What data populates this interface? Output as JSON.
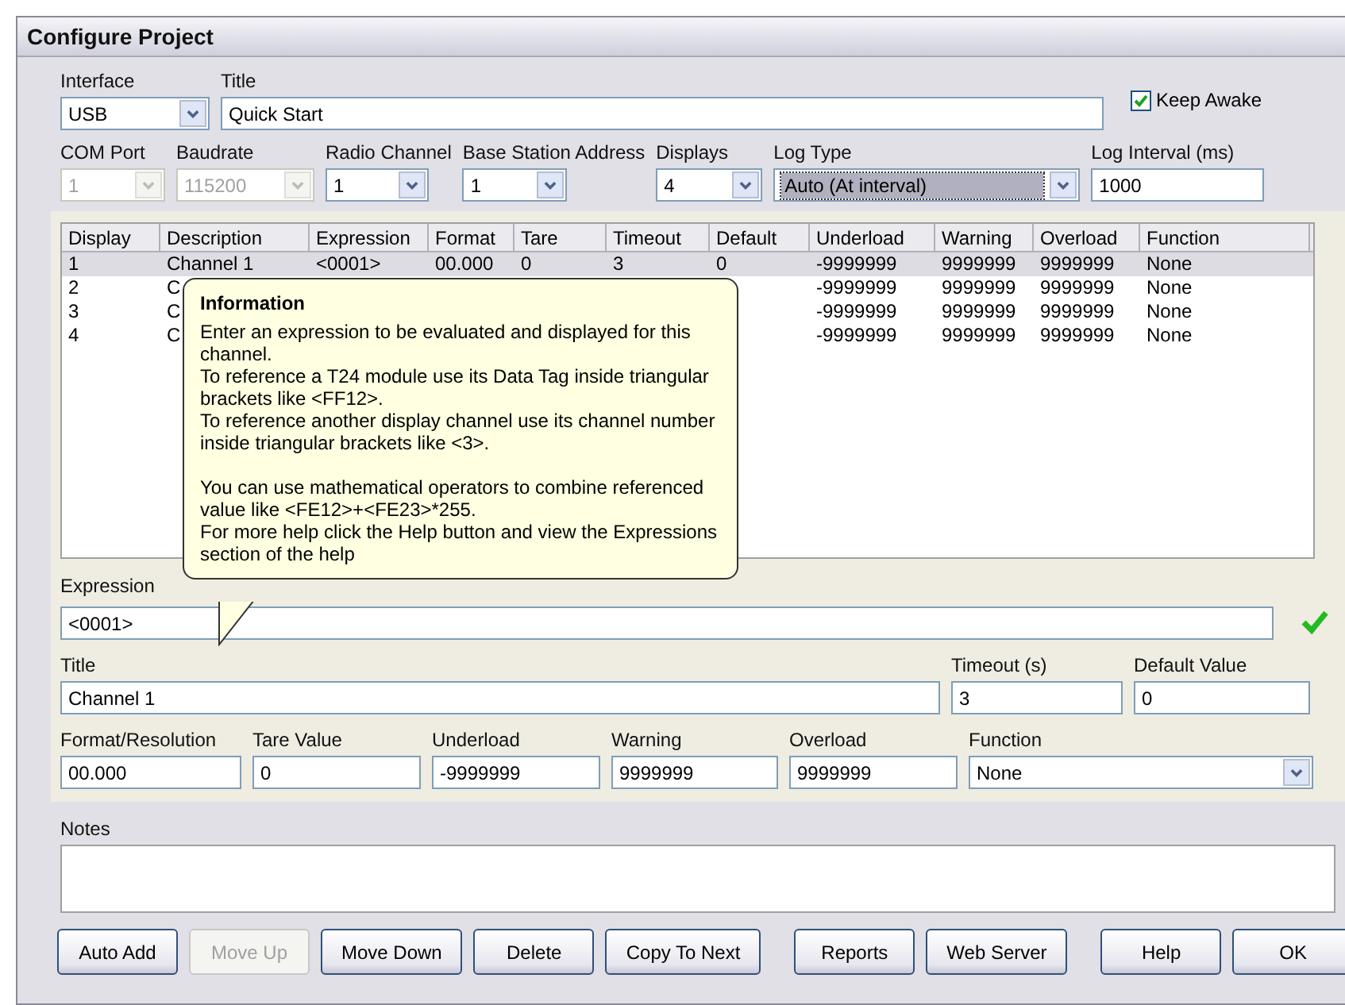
{
  "window": {
    "title": "Configure Project"
  },
  "top_rows": [
    [
      {
        "kind": "select",
        "label": "Interface",
        "value": "USB",
        "disabled": false
      },
      {
        "kind": "input",
        "label": "Title",
        "value": "Quick Start"
      },
      {
        "kind": "checkbox",
        "label": "Keep Awake",
        "checked": true
      }
    ],
    [
      {
        "kind": "select",
        "label": "COM Port",
        "value": "1",
        "disabled": true
      },
      {
        "kind": "select",
        "label": "Baudrate",
        "value": "115200",
        "disabled": true
      },
      {
        "kind": "select",
        "label": "Radio Channel",
        "value": "1",
        "disabled": false
      },
      {
        "kind": "select",
        "label": "Base Station Address",
        "value": "1",
        "disabled": false
      },
      {
        "kind": "select",
        "label": "Displays",
        "value": "4",
        "disabled": false
      },
      {
        "kind": "select",
        "label": "Log Type",
        "value": "Auto (At interval)",
        "disabled": false,
        "highlighted": true
      },
      {
        "kind": "input",
        "label": "Log Interval (ms)",
        "value": "1000"
      }
    ]
  ],
  "table": {
    "columns": [
      "Display",
      "Description",
      "Expression",
      "Format",
      "Tare",
      "Timeout",
      "Default",
      "Underload",
      "Warning",
      "Overload",
      "Function"
    ],
    "rows": [
      {
        "selected": true,
        "cells": [
          "1",
          "Channel 1",
          "<0001>",
          "00.000",
          "0",
          "3",
          "0",
          "-9999999",
          "9999999",
          "9999999",
          "None"
        ]
      },
      {
        "selected": false,
        "cells": [
          "2",
          "C",
          "",
          "",
          "",
          "",
          "",
          "-9999999",
          "9999999",
          "9999999",
          "None"
        ]
      },
      {
        "selected": false,
        "cells": [
          "3",
          "C",
          "",
          "",
          "",
          "",
          "",
          "-9999999",
          "9999999",
          "9999999",
          "None"
        ]
      },
      {
        "selected": false,
        "cells": [
          "4",
          "C",
          "",
          "",
          "",
          "",
          "",
          "-9999999",
          "9999999",
          "9999999",
          "None"
        ]
      }
    ]
  },
  "tooltip": {
    "title": "Information",
    "groups": [
      [
        "Enter an expression to be evaluated and displayed for this channel.",
        "To reference a T24 module use its Data Tag inside triangular brackets like <FF12>.",
        "To reference another display channel use its channel number inside triangular brackets like <3>."
      ],
      [
        "You can use mathematical operators to combine referenced value like <FE12>+<FE23>*255.",
        "For more help click the Help button and view the Expressions section of the help"
      ]
    ]
  },
  "expression": {
    "label": "Expression",
    "value": "<0001>",
    "valid": true
  },
  "detail_rows": [
    [
      {
        "kind": "input",
        "label": "Title",
        "value": "Channel 1"
      },
      {
        "kind": "input",
        "label": "Timeout (s)",
        "value": "3"
      },
      {
        "kind": "input",
        "label": "Default Value",
        "value": "0"
      }
    ],
    [
      {
        "kind": "input",
        "label": "Format/Resolution",
        "value": "00.000"
      },
      {
        "kind": "input",
        "label": "Tare Value",
        "value": "0"
      },
      {
        "kind": "input",
        "label": "Underload",
        "value": "-9999999"
      },
      {
        "kind": "input",
        "label": "Warning",
        "value": "9999999"
      },
      {
        "kind": "input",
        "label": "Overload",
        "value": "9999999"
      },
      {
        "kind": "select",
        "label": "Function",
        "value": "None",
        "disabled": false
      }
    ]
  ],
  "notes": {
    "label": "Notes"
  },
  "button_groups": [
    [
      {
        "label": "Auto Add",
        "disabled": false
      },
      {
        "label": "Move Up",
        "disabled": true
      },
      {
        "label": "Move Down",
        "disabled": false
      },
      {
        "label": "Delete",
        "disabled": false
      },
      {
        "label": "Copy To Next",
        "disabled": false
      }
    ],
    [
      {
        "label": "Reports",
        "disabled": false
      },
      {
        "label": "Web Server",
        "disabled": false
      }
    ],
    [
      {
        "label": "Help",
        "disabled": false
      },
      {
        "label": "OK",
        "disabled": false
      }
    ]
  ]
}
